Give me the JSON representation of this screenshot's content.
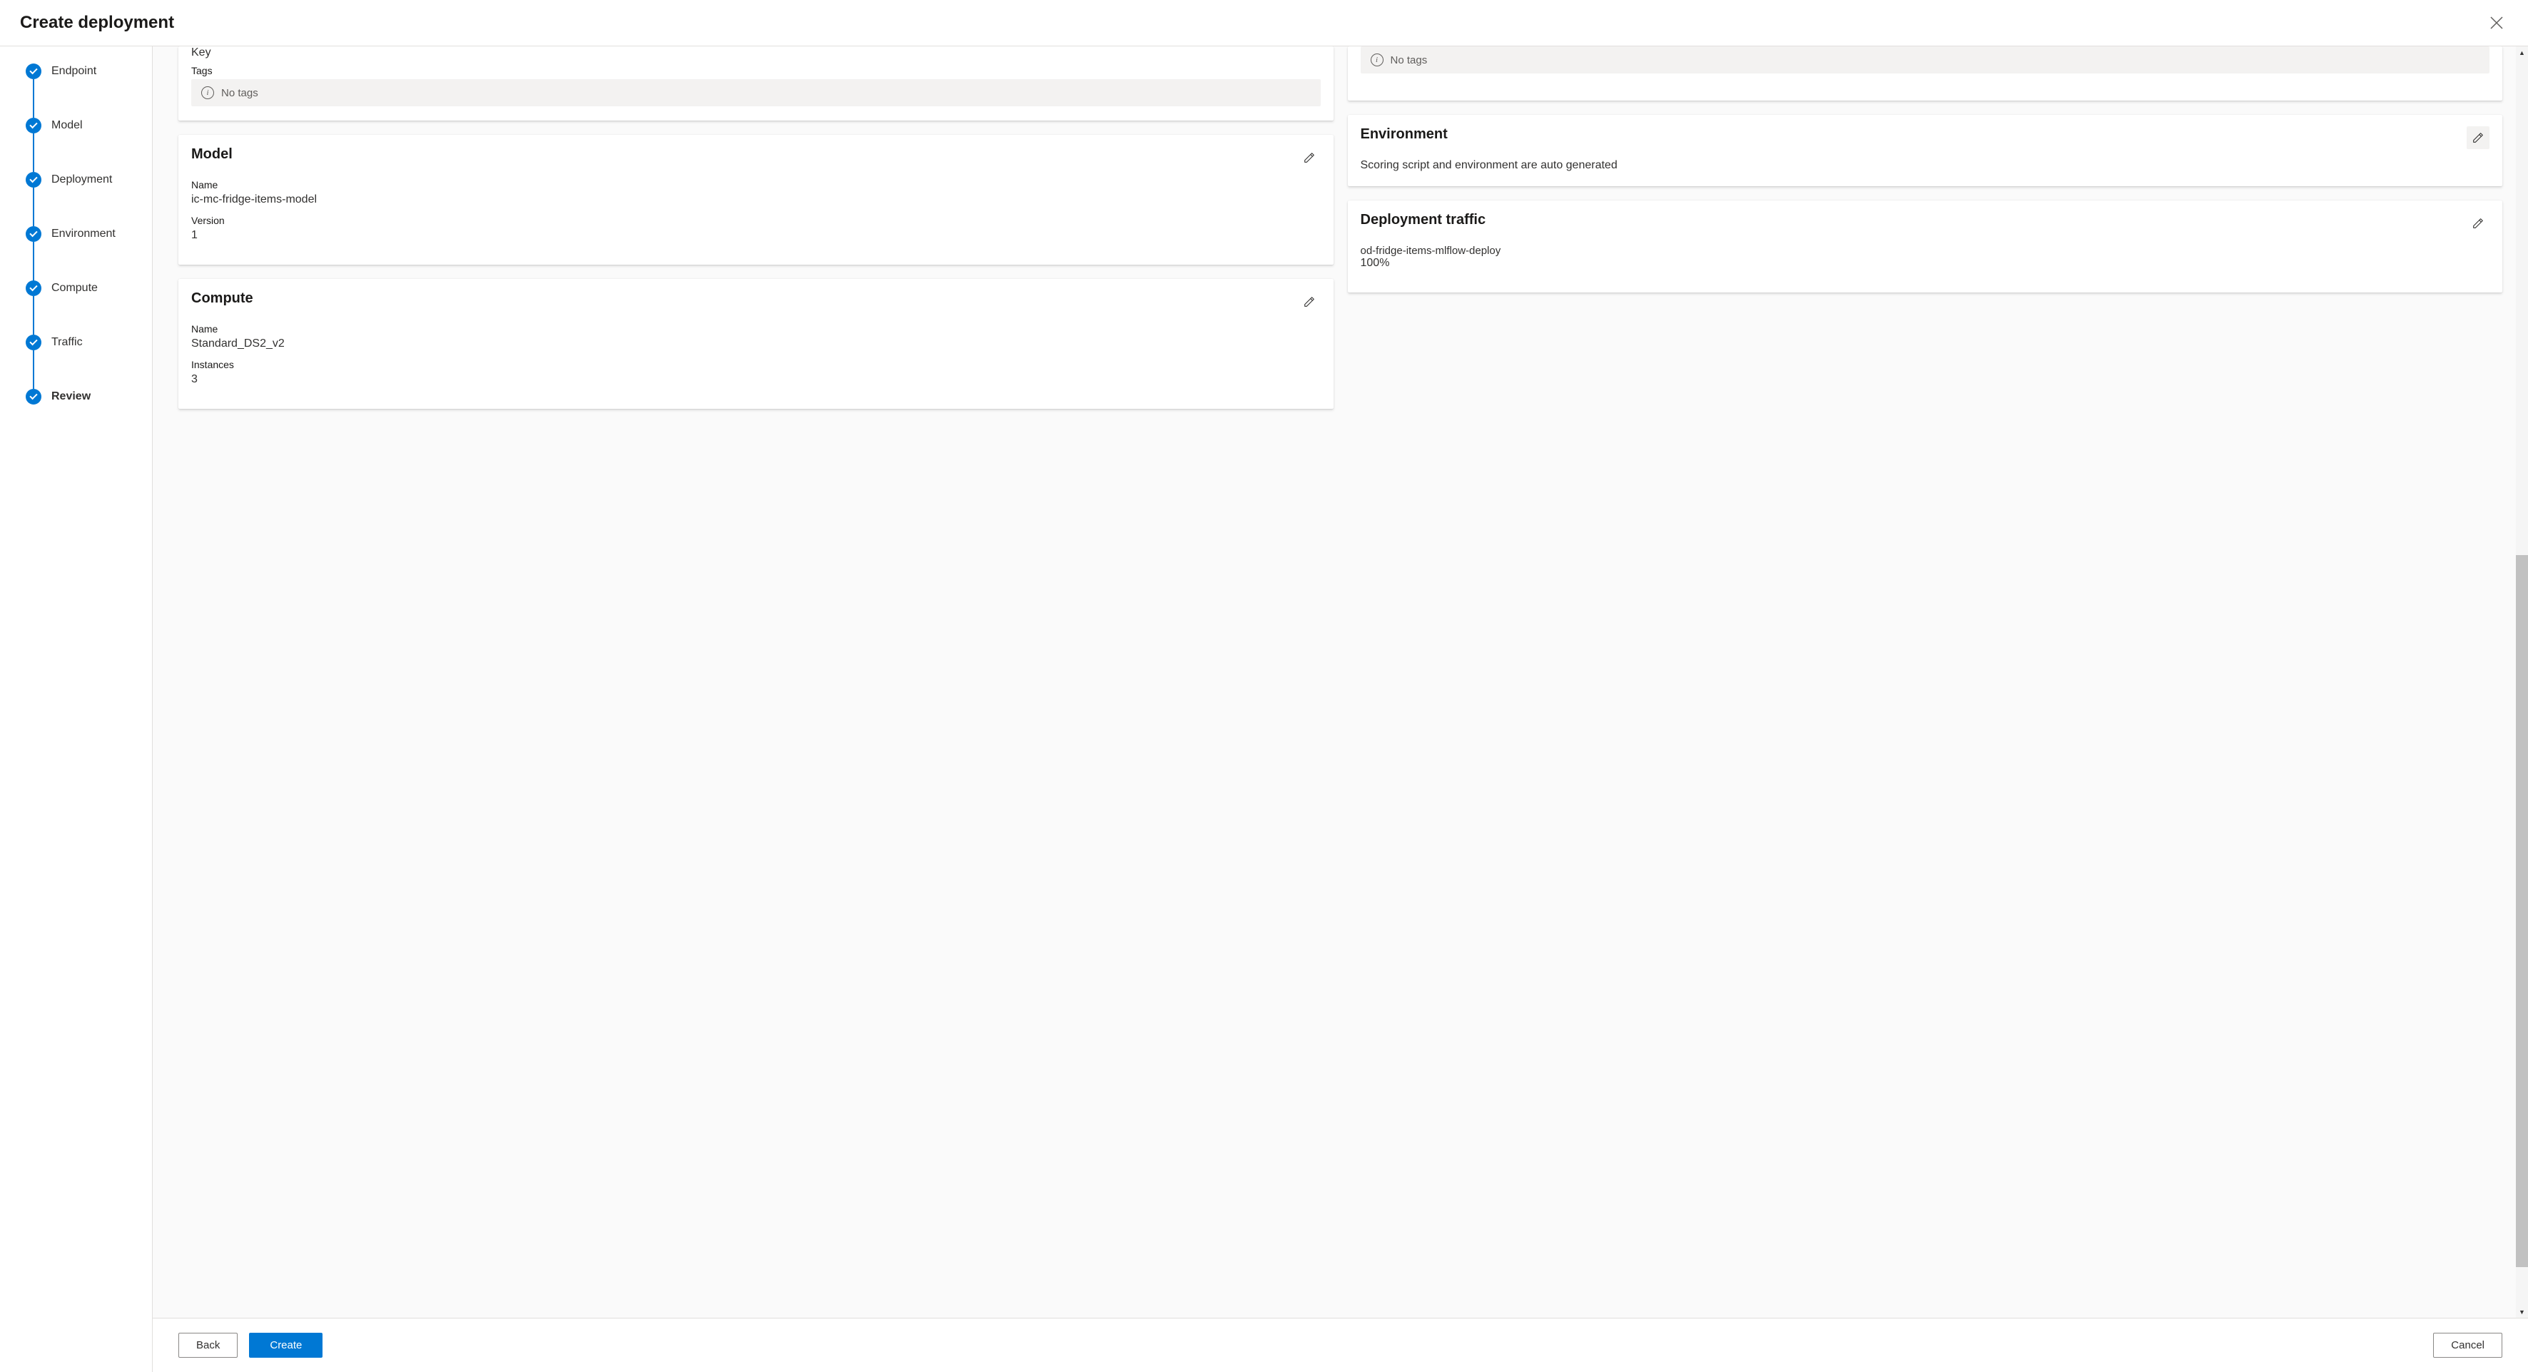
{
  "dialogTitle": "Create deployment",
  "steps": [
    {
      "label": "Endpoint",
      "active": false
    },
    {
      "label": "Model",
      "active": false
    },
    {
      "label": "Deployment",
      "active": false
    },
    {
      "label": "Environment",
      "active": false
    },
    {
      "label": "Compute",
      "active": false
    },
    {
      "label": "Traffic",
      "active": false
    },
    {
      "label": "Review",
      "active": true
    }
  ],
  "endpointCard": {
    "keyLabel": "Key",
    "tagsLabel": "Tags",
    "noTags": "No tags"
  },
  "modelCard": {
    "title": "Model",
    "nameLabel": "Name",
    "nameValue": "ic-mc-fridge-items-model",
    "versionLabel": "Version",
    "versionValue": "1"
  },
  "computeCard": {
    "title": "Compute",
    "nameLabel": "Name",
    "nameValue": "Standard_DS2_v2",
    "instancesLabel": "Instances",
    "instancesValue": "3"
  },
  "rightTopCard": {
    "noTags": "No tags"
  },
  "environmentCard": {
    "title": "Environment",
    "text": "Scoring script and environment are auto generated"
  },
  "trafficCard": {
    "title": "Deployment traffic",
    "deployName": "od-fridge-items-mlflow-deploy",
    "percent": "100%"
  },
  "buttons": {
    "back": "Back",
    "create": "Create",
    "cancel": "Cancel"
  }
}
